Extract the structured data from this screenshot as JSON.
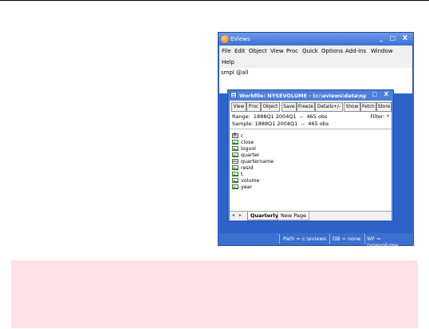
{
  "app": {
    "title": "EViews",
    "controls": "_ □ X",
    "menu": [
      "File",
      "Edit",
      "Object",
      "View",
      "Proc",
      "Quick",
      "Options",
      "Add-ins",
      "Window",
      "Help"
    ],
    "command": "smpl @all",
    "status": {
      "path": "Path = c:\\eviews",
      "db": "DB = none",
      "wf": "WF = nysevolume"
    }
  },
  "workfile": {
    "title": "Workfile: NYSEVOLUME - (c:\\eviews\\data\\nys...",
    "controls": "_ □ X",
    "toolbar": [
      "View",
      "Proc",
      "Object",
      "Save",
      "Freeze",
      "Details+/-",
      "Show",
      "Fetch",
      "Store"
    ],
    "range": "Range:  1888Q1 2004Q1  --  465 obs",
    "sample": "Sample: 1888Q1 2004Q1  --  465 obs",
    "filter": "Filter: *",
    "objects": [
      {
        "name": "c",
        "icon": "coef-icon"
      },
      {
        "name": "close",
        "icon": "series-icon"
      },
      {
        "name": "logvol",
        "icon": "series-icon"
      },
      {
        "name": "quarter",
        "icon": "series-icon"
      },
      {
        "name": "quartername",
        "icon": "alpha-icon"
      },
      {
        "name": "resid",
        "icon": "series-icon"
      },
      {
        "name": "t",
        "icon": "series-icon"
      },
      {
        "name": "volume",
        "icon": "series-icon"
      },
      {
        "name": "year",
        "icon": "series-icon"
      }
    ],
    "tab_arrows": "◂ ▸",
    "tabs": [
      "Quarterly",
      "New Page"
    ]
  },
  "colors": {
    "window_blue": "#3c6fcf",
    "notice_pink": "#ffe0e6"
  }
}
